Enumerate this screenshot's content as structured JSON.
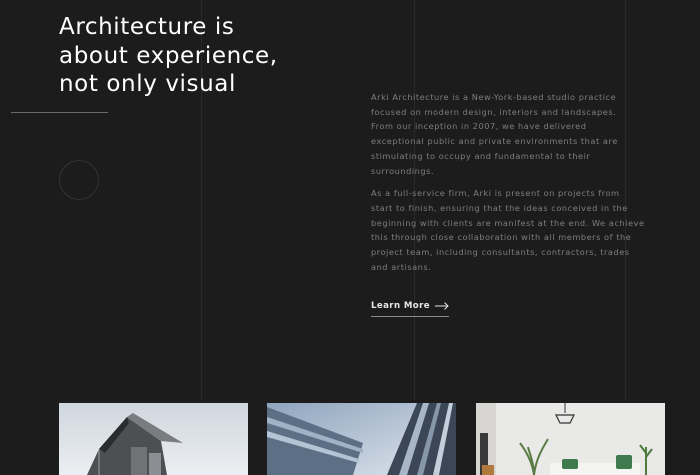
{
  "hero": {
    "headline_lines": [
      "Architecture is",
      "about experience,",
      "not only visual"
    ]
  },
  "about": {
    "paragraph1_lines": [
      "Arki Architecture is a New-York-based studio practice",
      "focused on modern design, interiors and landscapes.",
      "From our inception in 2007, we have delivered",
      "exceptional public and private environments that are",
      "stimulating to occupy and fundamental to their",
      "surroundings."
    ],
    "paragraph2_lines": [
      "As a full-service firm, Arki is present on projects from",
      "start to finish, ensuring that the ideas conceived in the",
      "beginning with clients are manifest at the end. We achieve",
      "this through close collaboration with all members of the",
      "project team, including consultants, contractors, trades",
      "and artisans."
    ],
    "cta_label": "Learn More",
    "cta_icon": "arrow-right-icon"
  },
  "gallery": [
    {
      "icon": "building-photo"
    },
    {
      "icon": "skyscraper-photo"
    },
    {
      "icon": "interior-photo"
    }
  ],
  "colors": {
    "background": "#1c1c1d",
    "heading": "#ffffff",
    "body_text": "#7e7e80",
    "gridline": "#2a2a2b"
  }
}
